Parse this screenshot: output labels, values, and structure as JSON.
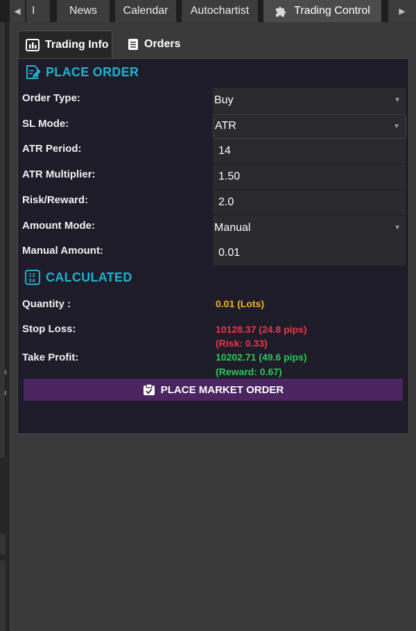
{
  "top_tabs": {
    "left_arrow": "◀",
    "partial": "I",
    "news": "News",
    "calendar": "Calendar",
    "autochartist": "Autochartist",
    "trading_control": "Trading Control",
    "right_arrow": "▶"
  },
  "sub_tabs": {
    "trading_info": "Trading Info",
    "orders": "Orders"
  },
  "place_order": {
    "title": "PLACE ORDER",
    "order_type": {
      "label": "Order Type:",
      "value": "Buy"
    },
    "sl_mode": {
      "label": "SL Mode:",
      "value": "ATR"
    },
    "atr_period": {
      "label": "ATR Period:",
      "value": "14"
    },
    "atr_multiplier": {
      "label": "ATR Multiplier:",
      "value": "1.50"
    },
    "risk_reward": {
      "label": "Risk/Reward:",
      "value": "2.0"
    },
    "amount_mode": {
      "label": "Amount Mode:",
      "value": "Manual"
    },
    "manual_amount": {
      "label": "Manual Amount:",
      "value": "0.01"
    }
  },
  "calculated": {
    "title": "CALCULATED",
    "quantity": {
      "label": "Quantity :",
      "value": "0.01 (Lots)"
    },
    "stop_loss": {
      "label": "Stop Loss:",
      "value": "10128.37 (24.8 pips)",
      "sub": "(Risk: 0.33)"
    },
    "take_profit": {
      "label": "Take Profit:",
      "value": "10202.71 (49.6 pips)",
      "sub": "(Reward: 0.67)"
    }
  },
  "place_market_order": "PLACE MARKET ORDER",
  "colors": {
    "accent": "#1fb2cf",
    "button": "#4a2560",
    "quantity": "#f2b424",
    "loss": "#e8364c",
    "profit": "#2ec55b"
  },
  "icons": {
    "trading_control": "puzzle-icon",
    "trading_info": "bar-chart-icon",
    "orders": "document-list-icon",
    "place_order": "edit-document-icon",
    "calculated": "calculator-icon",
    "market_order": "order-icon"
  }
}
